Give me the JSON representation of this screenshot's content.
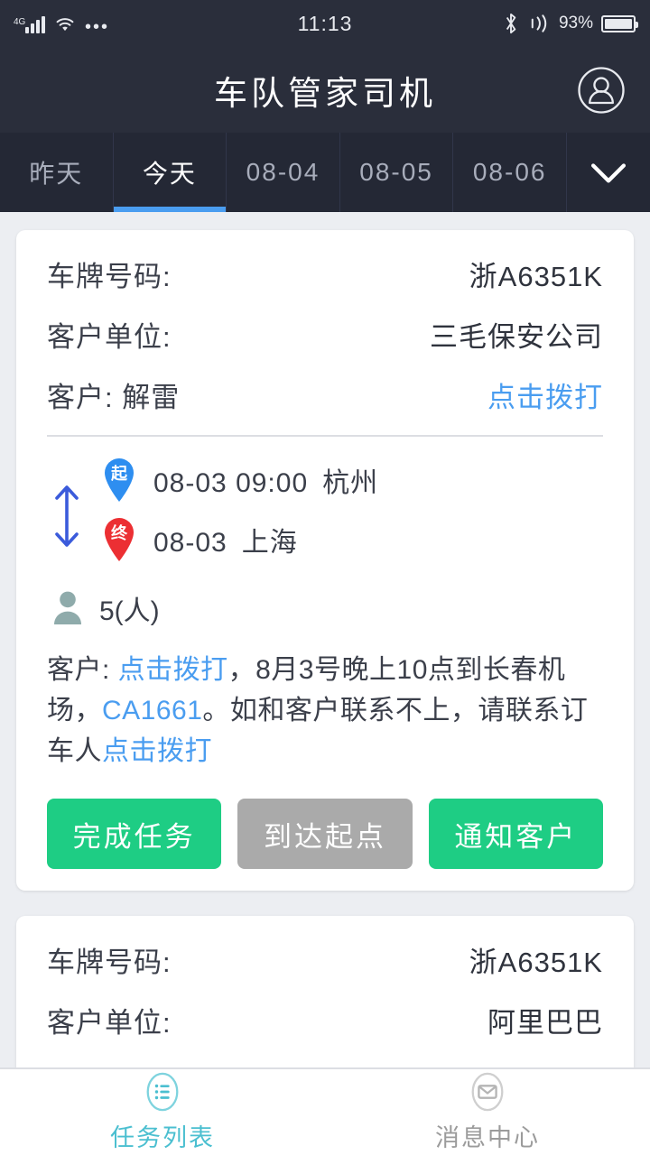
{
  "status_bar": {
    "network": "4G",
    "signal_icon": "signal-bars-icon",
    "wifi_icon": "wifi-icon",
    "more_icon": "more-dots-icon",
    "time": "11:13",
    "bluetooth_icon": "bluetooth-icon",
    "sound_icon": "sound-waves-icon",
    "battery_percent": "93%",
    "battery_icon": "battery-icon"
  },
  "header": {
    "title": "车队管家司机",
    "avatar_icon": "user-avatar-icon"
  },
  "tabs": {
    "items": [
      {
        "label": "昨天",
        "active": false
      },
      {
        "label": "今天",
        "active": true
      },
      {
        "label": "08-04",
        "active": false
      },
      {
        "label": "08-05",
        "active": false
      },
      {
        "label": "08-06",
        "active": false
      }
    ],
    "more_icon": "chevron-down-icon"
  },
  "cards": [
    {
      "plate_label": "车牌号码:",
      "plate_value": "浙A6351K",
      "company_label": "客户单位:",
      "company_value": "三毛保安公司",
      "customer_label": "客户: 解雷",
      "call_link": "点击拨打",
      "swap_icon": "swap-vertical-icon",
      "origin": {
        "pin_icon": "start-pin-icon",
        "pin_text": "起",
        "pin_color": "#2e8ef0",
        "datetime": "08-03 09:00",
        "city": "杭州"
      },
      "destination": {
        "pin_icon": "end-pin-icon",
        "pin_text": "终",
        "pin_color": "#ec2f33",
        "datetime": "08-03",
        "city": "上海"
      },
      "passenger_icon": "person-icon",
      "passenger_count": "5(人)",
      "note": {
        "prefix": "客户: ",
        "link1": "点击拨打",
        "mid1": "，8月3号晚上10点到长春机场，",
        "link2": "CA1661",
        "mid2": "。如和客户联系不上，请联系订车人",
        "link3": "点击拨打"
      },
      "buttons": [
        {
          "label": "完成任务",
          "style": "green"
        },
        {
          "label": "到达起点",
          "style": "gray"
        },
        {
          "label": "通知客户",
          "style": "green"
        }
      ]
    },
    {
      "plate_label": "车牌号码:",
      "plate_value": "浙A6351K",
      "company_label": "客户单位:",
      "company_value": "阿里巴巴"
    }
  ],
  "tabbar": {
    "items": [
      {
        "label": "任务列表",
        "icon": "list-icon",
        "active": true
      },
      {
        "label": "消息中心",
        "icon": "envelope-icon",
        "active": false
      }
    ]
  },
  "colors": {
    "header_bg": "#2a2e3b",
    "tabs_bg": "#242835",
    "page_bg": "#eceef2",
    "accent_blue": "#4a9df0",
    "accent_green": "#1ecd84",
    "accent_gray": "#aaaaaa",
    "accent_cyan": "#4bbfd0"
  }
}
